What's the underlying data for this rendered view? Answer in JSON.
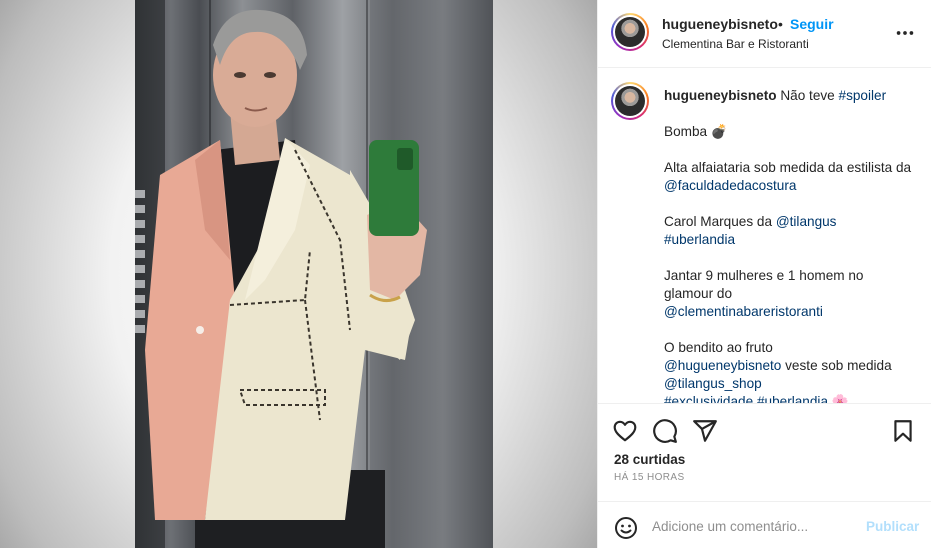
{
  "post": {
    "username": "hugueneybisneto",
    "dot": "•",
    "follow_label": "Seguir",
    "location": "Clementina Bar e Ristoranti",
    "more_icon": "more-horizontal-icon"
  },
  "caption": {
    "username": "hugueneybisneto",
    "intro": "Não teve ",
    "hashtag1": "#spoiler",
    "line_bomba": "Bomba 💣",
    "p2_text": "Alta alfaiataria sob medida da estilista da ",
    "p2_mention": "@faculdadedacostura",
    "p3_text": "Carol Marques da ",
    "p3_mention": "@tilangus",
    "p3_hashtag": "#uberlandia",
    "p4_text": "Jantar 9 mulheres e 1 homem no glamour do ",
    "p4_mention": "@clementinabareristoranti",
    "p5_text": "O bendito ao fruto ",
    "p5_mention1": "@hugueneybisneto",
    "p5_text2": " veste sob medida ",
    "p5_mention2": "@tilangus_shop",
    "p5_hashtag1": "#exclusividade",
    "p5_hashtag2": "#uberlandia",
    "p5_emoji": "🌸"
  },
  "actions": {
    "like_icon": "heart-icon",
    "comment_icon": "comment-bubble-icon",
    "share_icon": "paper-plane-icon",
    "save_icon": "bookmark-icon",
    "likes_text": "28 curtidas",
    "timestamp": "HÁ 15 HORAS"
  },
  "comment": {
    "emoji_icon": "smiley-icon",
    "placeholder": "Adicione um comentário...",
    "publish_label": "Publicar"
  },
  "colors": {
    "accent_blue": "#0095f6",
    "link_blue": "#00376b",
    "publish_disabled": "#b2dffc",
    "muted_gray": "#8e8e8e"
  }
}
